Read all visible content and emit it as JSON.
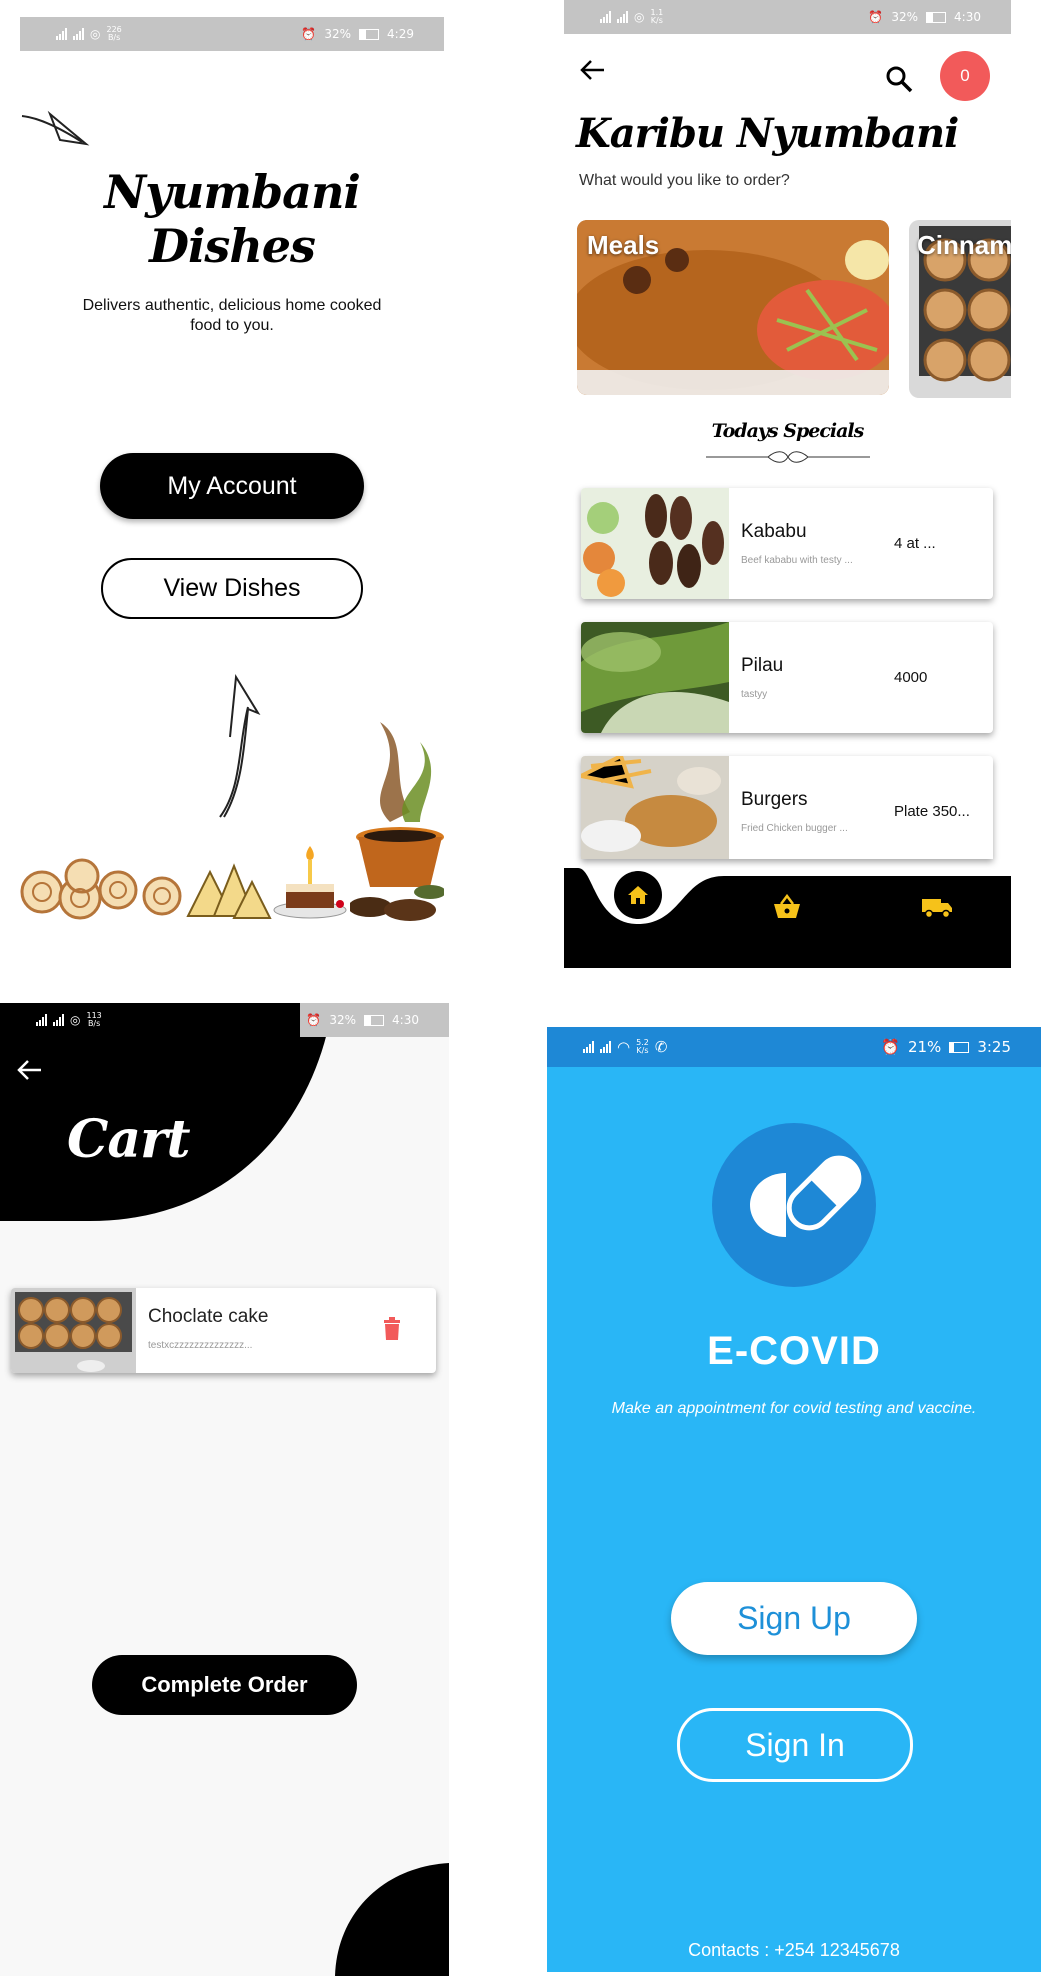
{
  "nyumbani_home": {
    "status": {
      "net": "226\nB/s",
      "battery": "32%",
      "time": "4:29"
    },
    "title": "Nyumbani Dishes",
    "tagline": "Delivers authentic, delicious home cooked food to you.",
    "my_account_label": "My Account",
    "view_dishes_label": "View Dishes"
  },
  "karibu": {
    "status": {
      "net": "1.1\nK/s",
      "battery": "32%",
      "time": "4:30"
    },
    "cart_count": "0",
    "title": "Karibu Nyumbani",
    "subtitle": "What would you like to order?",
    "categories": [
      {
        "label": "Meals"
      },
      {
        "label": "Cinnam"
      }
    ],
    "specials_heading": "Todays Specials",
    "dishes": [
      {
        "name": "Kababu",
        "desc": "Beef kababu with testy ...",
        "price": "4 at ..."
      },
      {
        "name": "Pilau",
        "desc": "tastyy",
        "price": "4000"
      },
      {
        "name": "Burgers",
        "desc": "Fried Chicken bugger ...",
        "price": "Plate 350..."
      }
    ]
  },
  "cart": {
    "status": {
      "net": "113\nB/s",
      "battery": "32%",
      "time": "4:30"
    },
    "title": "Cart",
    "item": {
      "name": "Choclate cake",
      "desc": "testxczzzzzzzzzzzzzz..."
    },
    "complete_label": "Complete Order"
  },
  "ecovid": {
    "status": {
      "net": "5.2\nK/s",
      "battery": "21%",
      "time": "3:25"
    },
    "title": "E-COVID",
    "tagline": "Make an appointment for covid testing and vaccine.",
    "signup_label": "Sign Up",
    "signin_label": "Sign In",
    "contacts": "Contacts : +254 12345678"
  },
  "colors": {
    "accent_red": "#f25a5a",
    "ecovid_blue": "#29b6f6",
    "ecovid_dark": "#1e88d6",
    "nav_yellow": "#f6c21a"
  }
}
